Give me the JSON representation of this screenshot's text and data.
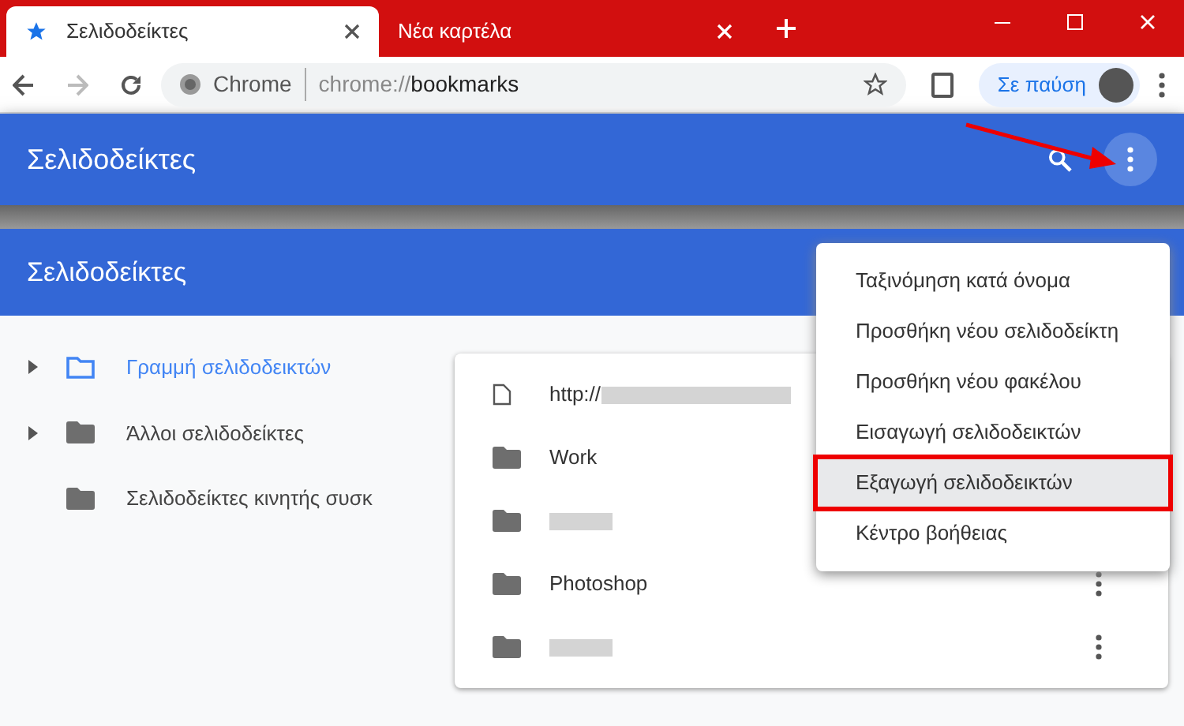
{
  "tabs": [
    {
      "label": "Σελιδοδείκτες",
      "selected": true
    },
    {
      "label": "Νέα καρτέλα",
      "selected": false
    }
  ],
  "address_bar": {
    "site_label": "Chrome",
    "url_scheme": "chrome://",
    "url_path": "bookmarks"
  },
  "profile_button": {
    "label": "Σε παύση"
  },
  "top_header": {
    "title": "Σελιδοδείκτες"
  },
  "header": {
    "title": "Σελιδοδείκτες"
  },
  "sidebar": {
    "items": [
      {
        "label": "Γραμμή σελιδοδεικτών",
        "expandable": true,
        "selected": true
      },
      {
        "label": "Άλλοι σελιδοδείκτες",
        "expandable": true,
        "selected": false
      },
      {
        "label": "Σελιδοδείκτες κινητής συσκ",
        "expandable": false,
        "selected": false
      }
    ]
  },
  "list": {
    "rows": [
      {
        "kind": "page",
        "name": "http://",
        "blurred": true
      },
      {
        "kind": "folder",
        "name": "Work",
        "blurred": false
      },
      {
        "kind": "folder",
        "name": "",
        "blurred": true
      },
      {
        "kind": "folder",
        "name": "Photoshop",
        "blurred": false
      },
      {
        "kind": "folder",
        "name": "",
        "blurred": true
      }
    ]
  },
  "menu": {
    "items": [
      {
        "label": "Ταξινόμηση κατά όνομα",
        "selected": false
      },
      {
        "label": "Προσθήκη νέου σελιδοδείκτη",
        "selected": false
      },
      {
        "label": "Προσθήκη νέου φακέλου",
        "selected": false
      },
      {
        "label": "Εισαγωγή σελιδοδεικτών",
        "selected": false
      },
      {
        "label": "Εξαγωγή σελιδοδεικτών",
        "selected": true
      },
      {
        "label": "Κέντρο βοήθειας",
        "selected": false
      }
    ]
  }
}
